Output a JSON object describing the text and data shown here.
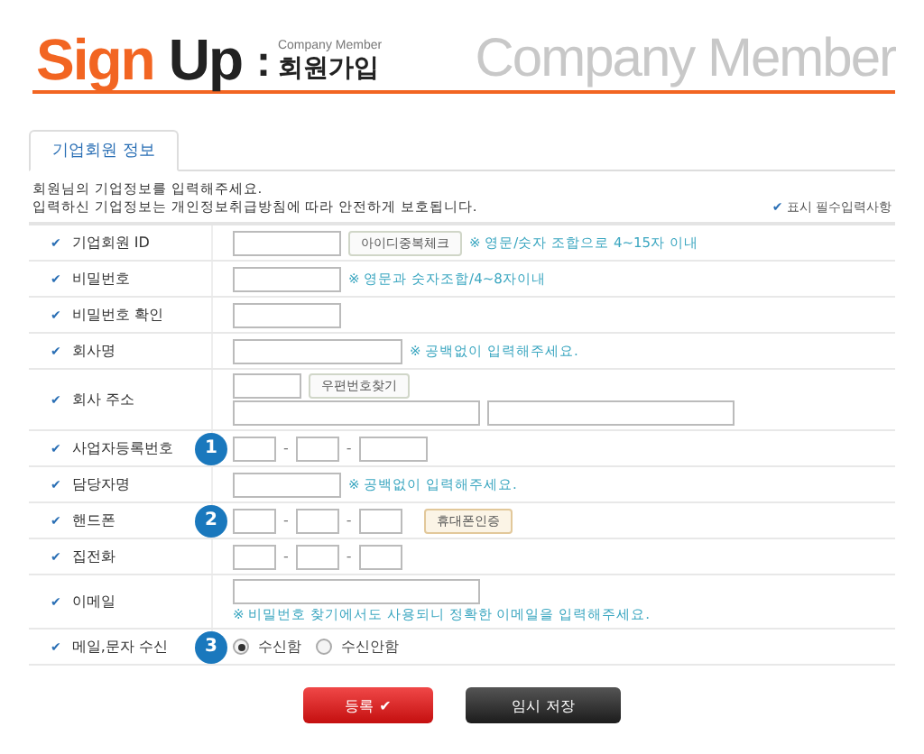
{
  "header": {
    "title_accent": "Sign",
    "title_rest": "Up",
    "colon": ":",
    "subtitle_small": "Company Member",
    "subtitle": "회원가입",
    "banner": "Company Member"
  },
  "tabs": [
    {
      "label": "기업회원 정보",
      "selected": true
    }
  ],
  "intro": [
    "회원님의 기업정보를 입력해주세요.",
    "입력하신 기업정보는 개인정보취급방침에 따라 안전하게 보호됩니다."
  ],
  "required_legend": {
    "mark": "✔",
    "text": "표시 필수입력사항"
  },
  "rows": [
    {
      "mark": "✔",
      "label": "기업회원 ID",
      "lines": [
        [
          {
            "kind": "input"
          },
          {
            "kind": "button",
            "label": "아이디중복체크"
          },
          {
            "kind": "hint",
            "text": "※ 영문/숫자 조합으로 4~15자 이내"
          }
        ]
      ]
    },
    {
      "mark": "✔",
      "label": "비밀번호",
      "lines": [
        [
          {
            "kind": "input"
          },
          {
            "kind": "hint",
            "text": "※ 영문과 숫자조합/4~8자이내"
          }
        ]
      ]
    },
    {
      "mark": "✔",
      "label": "비밀번호 확인",
      "lines": [
        [
          {
            "kind": "input"
          }
        ]
      ]
    },
    {
      "mark": "✔",
      "label": "회사명",
      "lines": [
        [
          {
            "kind": "long"
          },
          {
            "kind": "hint",
            "text": "※ 공백없이 입력해주세요."
          }
        ]
      ]
    },
    {
      "mark": "✔",
      "label": "회사 주소",
      "lines": [
        [
          {
            "kind": "short"
          },
          {
            "kind": "button",
            "label": "우편번호찾기"
          }
        ],
        [
          {
            "kind": "wide"
          },
          {
            "kind": "wide"
          }
        ]
      ]
    },
    {
      "mark": "✔",
      "label": "사업자등록번호",
      "badge": "1",
      "lines": [
        [
          {
            "kind": "tiny"
          },
          {
            "kind": "sep",
            "text": "-"
          },
          {
            "kind": "tiny"
          },
          {
            "kind": "sep",
            "text": "-"
          },
          {
            "kind": "short"
          }
        ]
      ]
    },
    {
      "mark": "✔",
      "label": "담당자명",
      "lines": [
        [
          {
            "kind": "input"
          },
          {
            "kind": "hint",
            "text": "※ 공백없이 입력해주세요."
          }
        ]
      ]
    },
    {
      "mark": "✔",
      "label": "핸드폰",
      "badge": "2",
      "lines": [
        [
          {
            "kind": "tiny"
          },
          {
            "kind": "sep",
            "text": "-"
          },
          {
            "kind": "tiny"
          },
          {
            "kind": "sep",
            "text": "-"
          },
          {
            "kind": "tiny"
          },
          {
            "kind": "accent",
            "label": "휴대폰인증"
          }
        ]
      ]
    },
    {
      "mark": "✔",
      "label": "집전화",
      "lines": [
        [
          {
            "kind": "tiny"
          },
          {
            "kind": "sep",
            "text": "-"
          },
          {
            "kind": "tiny"
          },
          {
            "kind": "sep",
            "text": "-"
          },
          {
            "kind": "tiny"
          }
        ]
      ]
    },
    {
      "mark": "✔",
      "label": "이메일",
      "lines": [
        [
          {
            "kind": "wide"
          }
        ],
        [
          {
            "kind": "hint",
            "text": "※ 비밀번호 찾기에서도 사용되니 정확한 이메일을 입력해주세요."
          }
        ]
      ]
    },
    {
      "mark": "✔",
      "label": "메일,문자 수신",
      "badge": "3",
      "lines": [
        [
          {
            "kind": "radio",
            "label": "수신함",
            "selected": true
          },
          {
            "kind": "radio",
            "label": "수신안함",
            "selected": false
          }
        ]
      ]
    }
  ],
  "actions": [
    {
      "kind": "primary",
      "label": "등록",
      "icon": "✔"
    },
    {
      "kind": "secondary",
      "label": "임시 저장"
    }
  ]
}
